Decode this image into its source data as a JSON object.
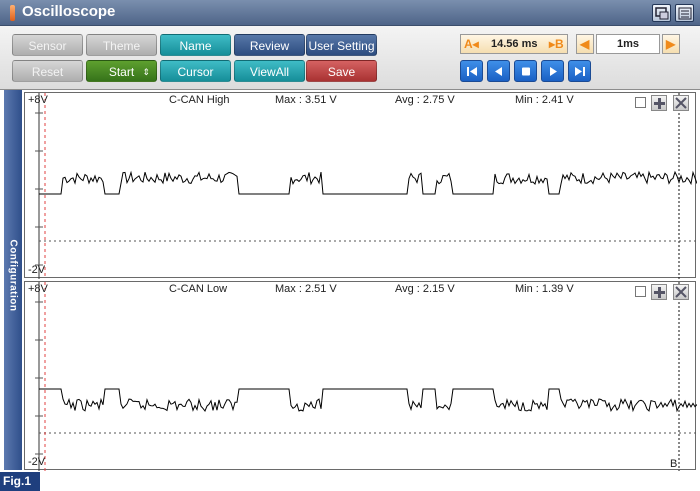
{
  "window": {
    "title": "Oscilloscope"
  },
  "toolbar": {
    "row1": [
      {
        "label": "Sensor",
        "style": "gray"
      },
      {
        "label": "Theme",
        "style": "gray"
      },
      {
        "label": "Name",
        "style": "teal"
      },
      {
        "label": "Review",
        "style": "navy"
      },
      {
        "label": "User Setting",
        "style": "navy"
      }
    ],
    "row2": [
      {
        "label": "Reset",
        "style": "gray"
      },
      {
        "label": "Start",
        "style": "green"
      },
      {
        "label": "Cursor",
        "style": "teal"
      },
      {
        "label": "ViewAll",
        "style": "teal"
      },
      {
        "label": "Save",
        "style": "red"
      }
    ],
    "cursor_a_label": "A",
    "cursor_b_label": "B",
    "cursor_delta": "14.56 ms",
    "timebase": "1ms"
  },
  "sidebar": {
    "label": "Configuration"
  },
  "channels": [
    {
      "top_scale": "+8V",
      "bottom_scale": "-2V",
      "name": "C-CAN High",
      "max": "Max : 3.51 V",
      "avg": "Avg : 2.75 V",
      "min": "Min : 2.41 V",
      "polarity": "high"
    },
    {
      "top_scale": "+8V",
      "bottom_scale": "-2V",
      "name": "C-CAN Low",
      "max": "Max : 2.51 V",
      "avg": "Avg : 2.15 V",
      "min": "Min : 1.39 V",
      "polarity": "low"
    }
  ],
  "cursor_marker": "B",
  "figure_label": "Fig.1",
  "colors": {
    "cursor_a": "#e04040",
    "waveform": "#000000",
    "titlebar": "#5d7295"
  }
}
